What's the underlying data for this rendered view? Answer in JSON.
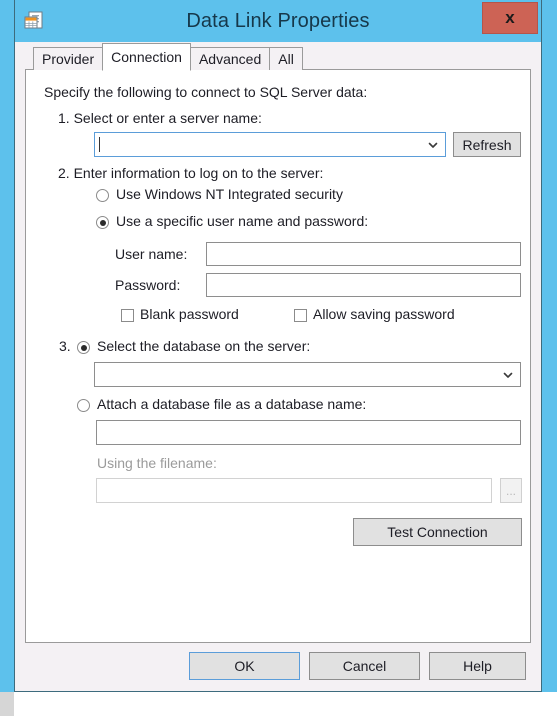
{
  "window": {
    "title": "Data Link Properties",
    "icon": "data-link-properties-icon",
    "close_label": "x"
  },
  "tabs": [
    {
      "label": "Provider",
      "active": false
    },
    {
      "label": "Connection",
      "active": true
    },
    {
      "label": "Advanced",
      "active": false
    },
    {
      "label": "All",
      "active": false
    }
  ],
  "connection": {
    "intro": "Specify the following to connect to SQL Server data:",
    "step1": {
      "label": "1. Select or enter a server name:",
      "server_value": "",
      "server_placeholder": "",
      "refresh_label": "Refresh",
      "focused": true
    },
    "step2": {
      "label": "2. Enter information to log on to the server:",
      "radio_windows_auth": {
        "label": "Use Windows NT Integrated security",
        "checked": false
      },
      "radio_specific_user": {
        "label": "Use a specific user name and password:",
        "checked": true
      },
      "username_label": "User name:",
      "username_value": "",
      "password_label": "Password:",
      "password_value": "",
      "blank_password": {
        "label": "Blank password",
        "checked": false
      },
      "allow_saving_password": {
        "label": "Allow saving password",
        "checked": false
      }
    },
    "step3": {
      "radio_select_database": {
        "prefix": "3.",
        "label": "Select the database on the server:",
        "checked": true
      },
      "database_value": "",
      "radio_attach_database": {
        "label": "Attach a database file as a database name:",
        "checked": false
      },
      "attach_name_value": "",
      "using_filename_label": "Using the filename:",
      "filename_value": "",
      "browse_label": "..."
    },
    "test_connection_label": "Test Connection"
  },
  "footer": {
    "ok_label": "OK",
    "cancel_label": "Cancel",
    "help_label": "Help"
  },
  "colors": {
    "desktop": "#5dc1ec",
    "titlebar": "#5dc1ec",
    "close_button": "#cd6355",
    "dialog_face": "#f4f1f4",
    "panel": "#ffffff",
    "focus_border": "#5b9dd9",
    "text": "#1d1d25",
    "disabled_text": "#9b9b9b"
  }
}
